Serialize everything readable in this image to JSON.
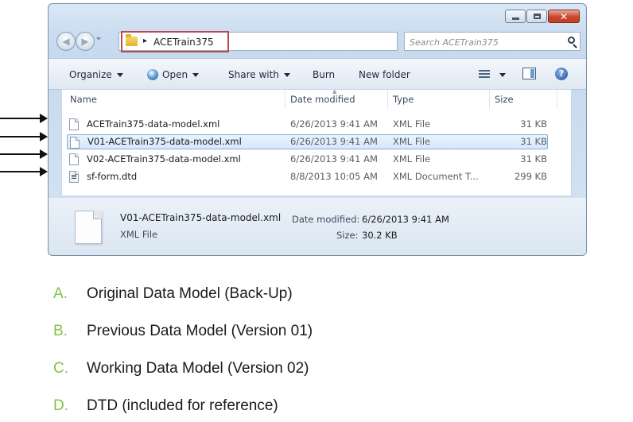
{
  "window": {
    "address": {
      "crumb": "ACETrain375"
    },
    "search": {
      "placeholder": "Search ACETrain375"
    },
    "toolbar": {
      "organize": "Organize",
      "open": "Open",
      "share_with": "Share with",
      "burn": "Burn",
      "new_folder": "New folder"
    },
    "columns": {
      "name": "Name",
      "date_modified": "Date modified",
      "type": "Type",
      "size": "Size"
    },
    "files": [
      {
        "name": "ACETrain375-data-model.xml",
        "date": "6/26/2013 9:41 AM",
        "type": "XML File",
        "size": "31 KB",
        "icon": "xml-file-icon"
      },
      {
        "name": "V01-ACETrain375-data-model.xml",
        "date": "6/26/2013 9:41 AM",
        "type": "XML File",
        "size": "31 KB",
        "icon": "xml-file-icon"
      },
      {
        "name": "V02-ACETrain375-data-model.xml",
        "date": "6/26/2013 9:41 AM",
        "type": "XML File",
        "size": "31 KB",
        "icon": "xml-file-icon"
      },
      {
        "name": "sf-form.dtd",
        "date": "8/8/2013 10:05 AM",
        "type": "XML Document T...",
        "size": "299 KB",
        "icon": "dtd-file-icon"
      }
    ],
    "selected_index": 1,
    "details": {
      "name": "V01-ACETrain375-data-model.xml",
      "type": "XML File",
      "date_label": "Date modified:",
      "date_value": "6/26/2013 9:41 AM",
      "size_label": "Size:",
      "size_value": "30.2 KB"
    }
  },
  "legend": [
    {
      "letter": "A.",
      "text": "Original Data Model (Back-Up)"
    },
    {
      "letter": "B.",
      "text": "Previous Data Model (Version 01)"
    },
    {
      "letter": "C.",
      "text": "Working Data Model (Version 02)"
    },
    {
      "letter": "D.",
      "text": "DTD (included for reference)"
    }
  ],
  "colors": {
    "legend_letter": "#82c341",
    "address_highlight": "#b94c50",
    "selection_border": "#84acdd",
    "arrow": "#111111"
  }
}
